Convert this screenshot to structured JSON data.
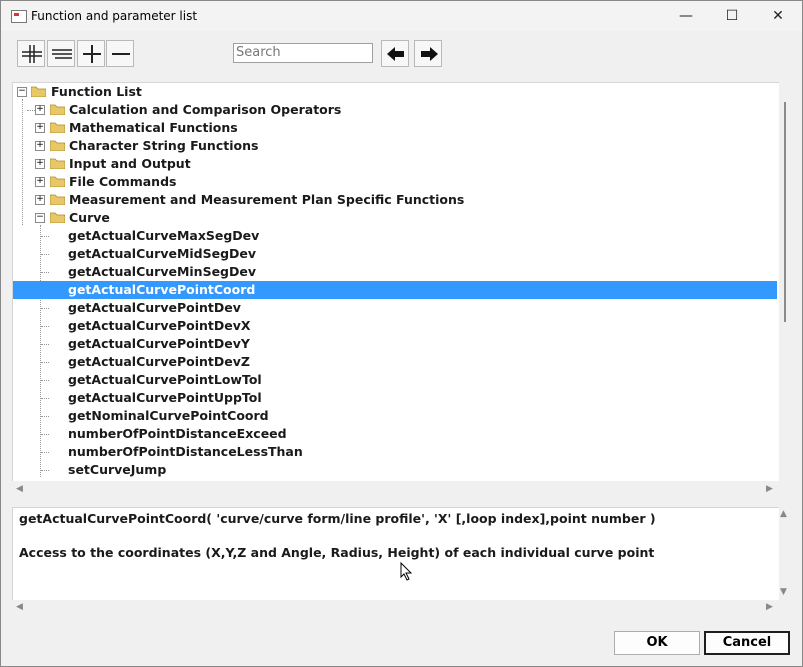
{
  "window": {
    "title": "Function and parameter list",
    "controls": {
      "minimize": "—",
      "maximize": "☐",
      "close": "✕"
    }
  },
  "toolbar": {
    "buttons": [
      "expand-all",
      "collapse-all",
      "expand",
      "collapse"
    ],
    "search": {
      "placeholder": "Search",
      "value": ""
    },
    "nav": [
      "back",
      "forward"
    ]
  },
  "tree": {
    "root": {
      "label": "Function List",
      "expanded": true
    },
    "folders": [
      {
        "label": "Calculation and Comparison Operators",
        "expanded": false
      },
      {
        "label": "Mathematical Functions",
        "expanded": false
      },
      {
        "label": "Character String Functions",
        "expanded": false
      },
      {
        "label": "Input and Output",
        "expanded": false
      },
      {
        "label": "File Commands",
        "expanded": false
      },
      {
        "label": "Measurement and Measurement Plan Specific Functions",
        "expanded": false
      },
      {
        "label": "Curve",
        "expanded": true
      }
    ],
    "curve_items": [
      "getActualCurveMaxSegDev",
      "getActualCurveMidSegDev",
      "getActualCurveMinSegDev",
      "getActualCurvePointCoord",
      "getActualCurvePointDev",
      "getActualCurvePointDevX",
      "getActualCurvePointDevY",
      "getActualCurvePointDevZ",
      "getActualCurvePointLowTol",
      "getActualCurvePointUppTol",
      "getNominalCurvePointCoord",
      "numberOfPointDistanceExceed",
      "numberOfPointDistanceLessThan",
      "setCurveJump"
    ],
    "selected": "getActualCurvePointCoord"
  },
  "description": {
    "signature": "getActualCurvePointCoord( 'curve/curve form/line profile', 'X' [,loop index],point number )",
    "text": "Access to the coordinates (X,Y,Z and Angle, Radius, Height) of each individual curve point"
  },
  "buttons": {
    "ok": "OK",
    "cancel": "Cancel"
  },
  "colors": {
    "selection": "#3399ff",
    "folder": "#e8c766"
  }
}
